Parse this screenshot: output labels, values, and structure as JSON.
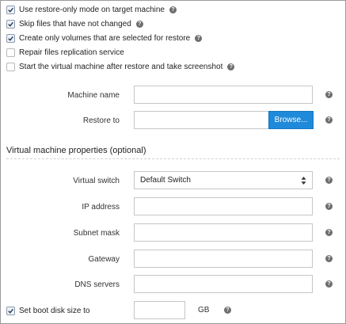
{
  "options": [
    {
      "label": "Use restore-only mode on target machine",
      "checked": true,
      "help": true
    },
    {
      "label": "Skip files that have not changed",
      "checked": true,
      "help": true
    },
    {
      "label": "Create only volumes that are selected for restore",
      "checked": true,
      "help": true
    },
    {
      "label": "Repair files replication service",
      "checked": false,
      "help": false
    },
    {
      "label": "Start the virtual machine after restore and take screenshot",
      "checked": false,
      "help": true
    }
  ],
  "machine_name": {
    "label": "Machine name",
    "value": ""
  },
  "restore_to": {
    "label": "Restore to",
    "value": "",
    "browse_label": "Browse..."
  },
  "vm_section": {
    "title": "Virtual machine properties (optional)"
  },
  "virtual_switch": {
    "label": "Virtual switch",
    "selected": "Default Switch"
  },
  "ip_address": {
    "label": "IP address",
    "value": ""
  },
  "subnet_mask": {
    "label": "Subnet mask",
    "value": ""
  },
  "gateway": {
    "label": "Gateway",
    "value": ""
  },
  "dns_servers": {
    "label": "DNS servers",
    "value": ""
  },
  "boot_disk": {
    "label": "Set boot disk size to",
    "checked": true,
    "value": "",
    "unit": "GB"
  },
  "help_glyph": "?",
  "colors": {
    "accent": "#1f8ad9",
    "help_icon": "#6e6e6e"
  }
}
